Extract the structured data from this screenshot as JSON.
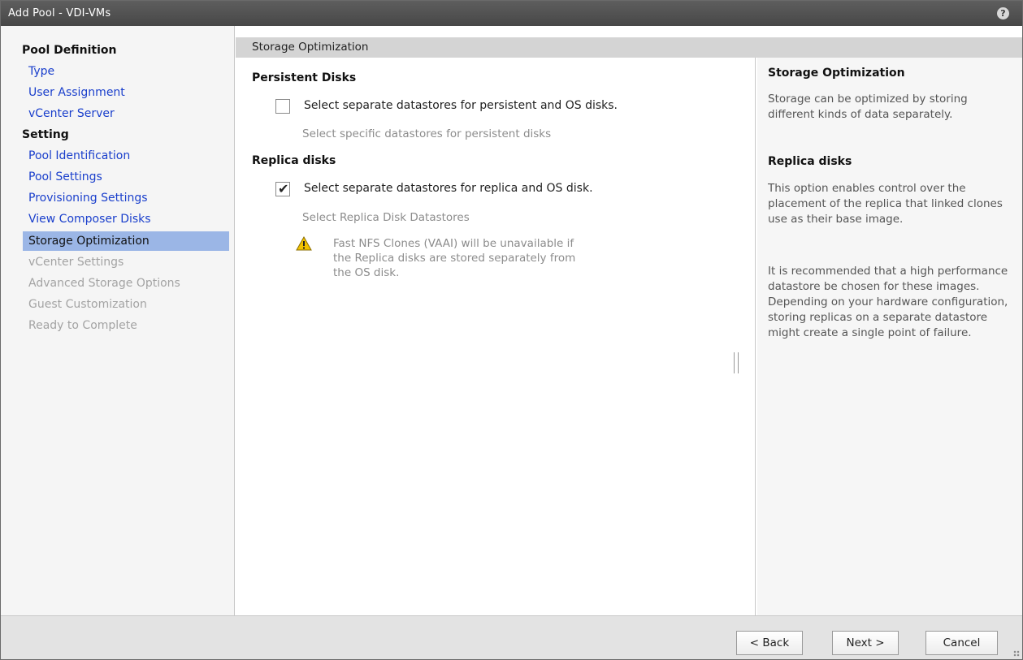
{
  "window": {
    "title": "Add Pool - VDI-VMs",
    "help_icon": "question-mark-icon"
  },
  "sidebar": {
    "sections": [
      {
        "heading": "Pool Definition",
        "items": [
          "Type",
          "User Assignment",
          "vCenter Server"
        ]
      },
      {
        "heading": "Setting",
        "items": [
          "Pool Identification",
          "Pool Settings",
          "Provisioning Settings",
          "View Composer Disks",
          "Storage Optimization",
          "vCenter Settings",
          "Advanced Storage Options",
          "Guest Customization",
          "Ready to Complete"
        ]
      }
    ],
    "pool_definition_heading": "Pool Definition",
    "setting_heading": "Setting",
    "items": {
      "type": "Type",
      "user_assignment": "User Assignment",
      "vcenter_server": "vCenter Server",
      "pool_identification": "Pool Identification",
      "pool_settings": "Pool Settings",
      "provisioning_settings": "Provisioning Settings",
      "view_composer_disks": "View Composer Disks",
      "storage_optimization": "Storage Optimization",
      "vcenter_settings": "vCenter Settings",
      "advanced_storage_options": "Advanced Storage Options",
      "guest_customization": "Guest Customization",
      "ready_to_complete": "Ready to Complete"
    },
    "selected": "Storage Optimization"
  },
  "main": {
    "header": "Storage Optimization",
    "persistent": {
      "title": "Persistent Disks",
      "checkbox_label": "Select separate datastores for persistent and OS disks.",
      "checked": false,
      "link": "Select specific datastores for persistent disks"
    },
    "replica": {
      "title": "Replica disks",
      "checkbox_label": "Select separate datastores for replica and OS disk.",
      "checked": true,
      "link": "Select Replica Disk Datastores",
      "warning_line1": "Fast NFS Clones (VAAI) will be unavailable if",
      "warning_line2": "the Replica disks are stored separately from",
      "warning_line3": "the OS disk."
    }
  },
  "help": {
    "title1": "Storage Optimization",
    "text1": "Storage can be optimized by storing different kinds of data separately.",
    "title2": "Replica disks",
    "text2": "This option enables control over the placement of the replica that linked clones use as their base image.",
    "text3": "It is recommended that a high performance datastore be chosen for these images. Depending on your hardware configuration, storing replicas on a separate datastore might create a single point of failure."
  },
  "footer": {
    "back": "< Back",
    "next": "Next >",
    "cancel": "Cancel"
  },
  "colors": {
    "titlebar": "#4f4f4f",
    "link": "#1a3fcc",
    "selected": "#9bb6e6",
    "warning": "#f2c200"
  }
}
